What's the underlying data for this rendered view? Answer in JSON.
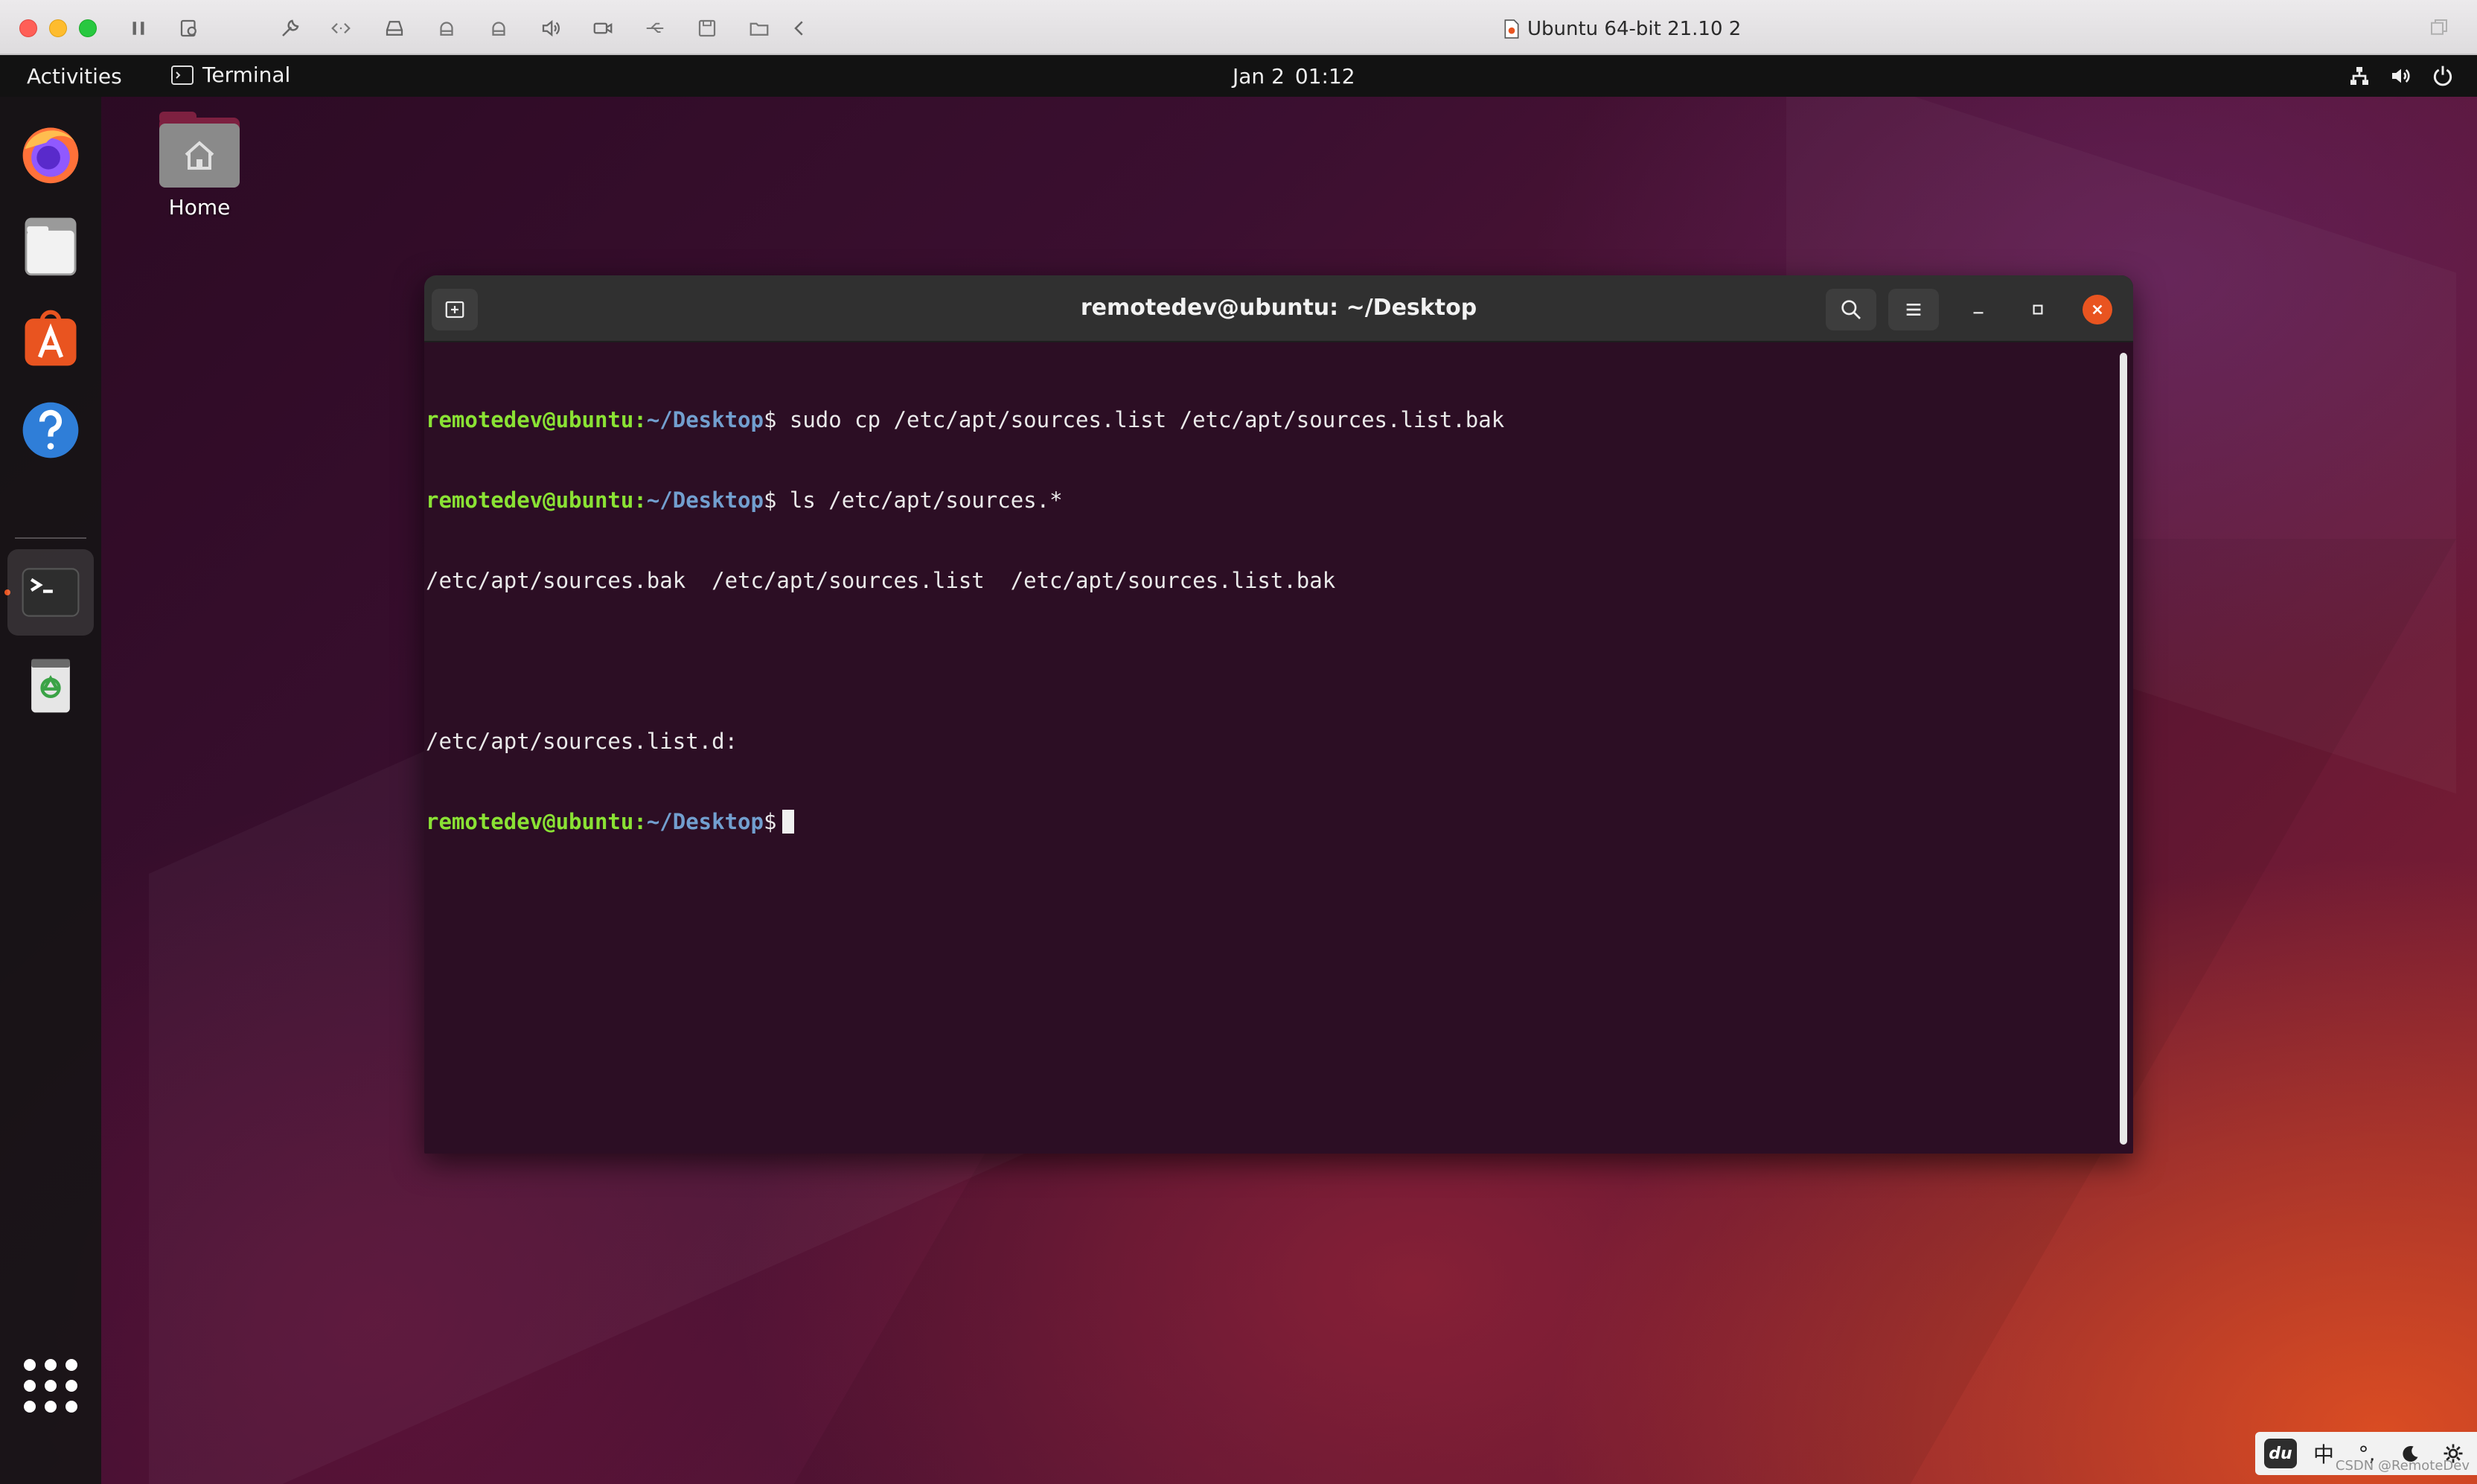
{
  "host": {
    "window_title": "Ubuntu 64-bit 21.10 2",
    "toolbar_icons": [
      "pause-icon",
      "snapshot-icon",
      "wrench-icon",
      "code-icon",
      "hard-disk-icon",
      "printer-icon",
      "camera-icon",
      "sound-icon",
      "video-icon",
      "usb-icon",
      "floppy-icon",
      "shared-folder-icon",
      "back-icon"
    ]
  },
  "panel": {
    "activities": "Activities",
    "app_name": "Terminal",
    "date": "Jan 2",
    "time": "01:12",
    "tray_icons": [
      "network-icon",
      "volume-icon",
      "power-icon"
    ]
  },
  "dock": {
    "items": [
      "firefox-icon",
      "files-icon",
      "software-icon",
      "help-icon",
      "terminal-icon",
      "trash-icon"
    ],
    "apps_grid": "show-apps-icon"
  },
  "desktop_icons": [
    {
      "label": "Home",
      "icon": "home-folder-icon"
    }
  ],
  "terminal": {
    "title": "remotedev@ubuntu: ~/Desktop",
    "prompt_user": "remotedev@ubuntu:",
    "prompt_path": "~/Desktop",
    "prompt_symbol": "$",
    "commands": [
      " sudo cp /etc/apt/sources.list /etc/apt/sources.list.bak",
      " ls /etc/apt/sources.*"
    ],
    "output": [
      "/etc/apt/sources.bak  /etc/apt/sources.list  /etc/apt/sources.list.bak",
      "",
      "/etc/apt/sources.list.d:"
    ]
  },
  "ime": {
    "logo": "du",
    "mode": "中",
    "punct": "°,",
    "items": [
      "moon-icon",
      "gear-icon"
    ]
  },
  "watermark": "CSDN @RemoteDev"
}
